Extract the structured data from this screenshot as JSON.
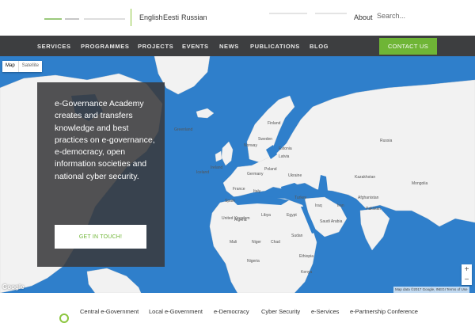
{
  "languages": [
    "English",
    "Eesti",
    "Russian"
  ],
  "top_links": {
    "about": "About"
  },
  "search": {
    "placeholder": "Search..."
  },
  "nav": {
    "items": [
      "SERVICES",
      "PROGRAMMES",
      "PROJECTS",
      "EVENTS",
      "NEWS",
      "PUBLICATIONS",
      "BLOG"
    ],
    "contact_label": "CONTACT US"
  },
  "map": {
    "type_map": "Map",
    "type_satellite": "Satellite",
    "google_logo": "Google",
    "attribution": "Map data ©2017 Google, INEGI   Terms of Use",
    "zoom_in": "+",
    "zoom_out": "−",
    "labels": [
      "Finland",
      "Sweden",
      "Norway",
      "Estonia",
      "Latvia",
      "Poland",
      "Germany",
      "Ukraine",
      "France",
      "Spain",
      "Italy",
      "Turkey",
      "Kazakhstan",
      "Iran",
      "Iraq",
      "Saudi Arabia",
      "Egypt",
      "Libya",
      "Algeria",
      "Mali",
      "Niger",
      "Sudan",
      "Chad",
      "Nigeria",
      "Ethiopia",
      "Kenya",
      "Afghanistan",
      "Pakistan",
      "Russia",
      "Mongolia",
      "Greenland",
      "Iceland",
      "Ireland",
      "United Kingdom"
    ]
  },
  "hero": {
    "text": "e-Governance Academy creates and transfers knowledge and best practices on e-governance, e-democracy, open information societies and national cyber security.",
    "cta_label": "GET IN TOUCH!"
  },
  "footer": {
    "items": [
      "Central e-Government",
      "Local e-Government",
      "e-Democracy",
      "Cyber Security",
      "e-Services",
      "e-Partnership Conference"
    ]
  },
  "colors": {
    "accent": "#6fb536",
    "nav_bg": "#3d3e40",
    "ocean": "#2f7fcb",
    "land": "#f2f2f2"
  }
}
